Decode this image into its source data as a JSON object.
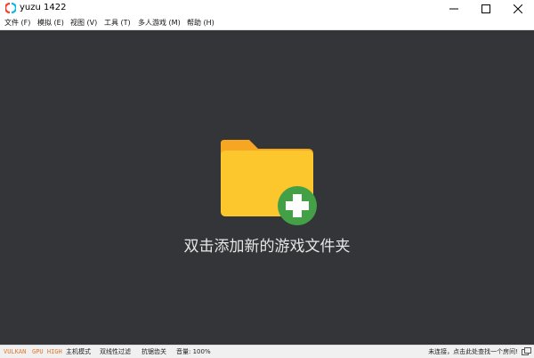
{
  "window": {
    "title": "yuzu 1422",
    "controls": [
      "minimize-icon",
      "maximize-icon",
      "close-icon"
    ]
  },
  "menu": {
    "items": [
      {
        "label": "文件 (F)"
      },
      {
        "label": "模拟 (E)"
      },
      {
        "label": "视图 (V)"
      },
      {
        "label": "工具 (T)"
      },
      {
        "label": "多人游戏 (M)"
      },
      {
        "label": "帮助 (H)"
      }
    ]
  },
  "main": {
    "add_folder_label": "双击添加新的游戏文件夹",
    "icon": "folder-add-icon",
    "colors": {
      "background": "#333538",
      "folder": "#fcc72c",
      "folder_tab": "#f6a623",
      "plus_circle": "#43a047"
    }
  },
  "status": {
    "api": "VULKAN",
    "gpu": "GPU HIGH",
    "dock_mode": "主机模式",
    "filter": "双线性过滤",
    "antialias": "抗锯齿关",
    "volume": "音量: 100%",
    "room": "未连接，点击此处查找一个房间!",
    "accent_color": "#e0782a"
  }
}
